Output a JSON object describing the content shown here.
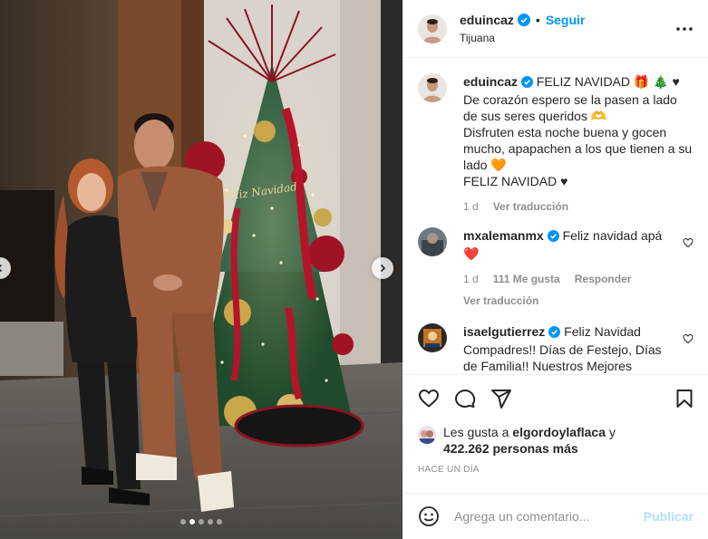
{
  "post": {
    "author": "eduincaz",
    "follow_label": "Seguir",
    "separator": "•",
    "location": "Tijuana",
    "more_icon": "more-horizontal-icon"
  },
  "media": {
    "slides_total": 5,
    "active_slide_index": 1,
    "next_icon": "chevron-right-icon",
    "prev_icon": "chevron-left-icon",
    "ornament_text": "Feliz Navidad"
  },
  "caption": {
    "username": "eduincaz",
    "lines": [
      "FELIZ NAVIDAD 🎁 🎄 ♥",
      "De corazón espero se la pasen a lado de sus seres queridos 🫶",
      "Disfruten esta noche buena y gocen mucho, apapachen a los que tienen a su lado 🧡",
      "FELIZ NAVIDAD ♥"
    ],
    "time": "1 d",
    "translate": "Ver traducción"
  },
  "comments": [
    {
      "username": "mxalemanmx",
      "text": "Feliz navidad apá ❤️",
      "time": "1 d",
      "likes": "111 Me gusta",
      "reply": "Responder",
      "translate": "Ver traducción"
    },
    {
      "username": "isaelgutierrez",
      "text": "Feliz Navidad Compadres!! Días de Festejo, Días de Familia!! Nuestros Mejores"
    }
  ],
  "likes": {
    "prefix": "Les gusta a",
    "user": "elgordoylaflaca",
    "conj": "y",
    "others": "422.262 personas más"
  },
  "timestamp": "HACE UN DÍA",
  "composer": {
    "placeholder": "Agrega un comentario...",
    "publish": "Publicar"
  },
  "colors": {
    "accent": "#0095f6",
    "verified": "#0095f6",
    "muted": "#8e8e8e",
    "publish_disabled": "#b2dffc"
  }
}
